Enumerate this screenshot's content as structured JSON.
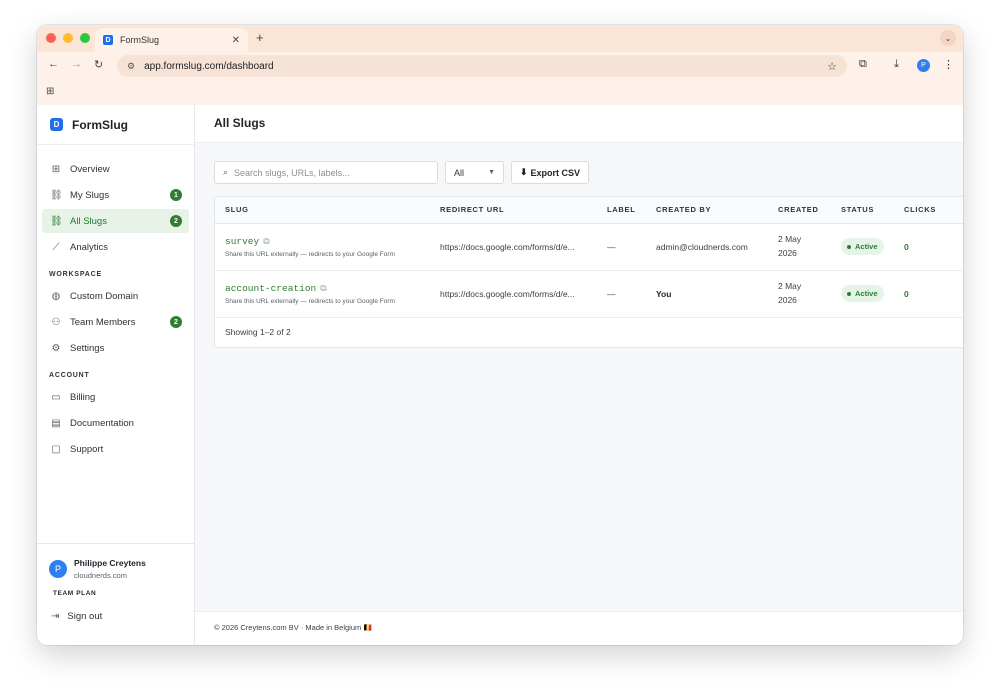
{
  "browser": {
    "tab_title": "FormSlug",
    "new_tab": "+",
    "url": "app.formslug.com/dashboard",
    "profile_initial": "P"
  },
  "brand": {
    "name": "FormSlug",
    "logo_letter": "D"
  },
  "sidebar": {
    "items": [
      {
        "label": "Overview",
        "icon": "grid-icon",
        "glyph": "⊞"
      },
      {
        "label": "My Slugs",
        "icon": "link-icon",
        "glyph": "🔗",
        "badge": "1"
      },
      {
        "label": "All Slugs",
        "icon": "link-icon",
        "glyph": "🔗",
        "badge": "2",
        "active": true
      },
      {
        "label": "Analytics",
        "icon": "chart-icon",
        "glyph": "📈"
      }
    ],
    "workspace_label": "WORKSPACE",
    "workspace_items": [
      {
        "label": "Custom Domain",
        "icon": "globe-icon",
        "glyph": "🌐"
      },
      {
        "label": "Team Members",
        "icon": "users-icon",
        "glyph": "👥",
        "badge": "2"
      },
      {
        "label": "Settings",
        "icon": "gear-icon",
        "glyph": "⚙"
      }
    ],
    "account_label": "ACCOUNT",
    "account_items": [
      {
        "label": "Billing",
        "icon": "credit-card-icon",
        "glyph": "▭"
      },
      {
        "label": "Documentation",
        "icon": "document-icon",
        "glyph": "📄"
      },
      {
        "label": "Support",
        "icon": "chat-icon",
        "glyph": "💬"
      }
    ],
    "user": {
      "initial": "P",
      "name": "Philippe Creytens",
      "domain": "cloudnerds.com",
      "plan": "TEAM PLAN"
    },
    "signout_label": "Sign out"
  },
  "main": {
    "title": "All Slugs",
    "search_placeholder": "Search slugs, URLs, labels...",
    "filter_value": "All",
    "export_label": "Export CSV",
    "columns": [
      "SLUG",
      "REDIRECT URL",
      "LABEL",
      "CREATED BY",
      "CREATED",
      "STATUS",
      "CLICKS"
    ],
    "rows": [
      {
        "slug": "survey",
        "help": "Share this URL externally — redirects to your Google Form",
        "redirect": "https://docs.google.com/forms/d/e...",
        "label": "—",
        "created_by": "admin@cloudnerds.com",
        "created_line1": "2 May",
        "created_line2": "2026",
        "status": "Active",
        "clicks": "0"
      },
      {
        "slug": "account-creation",
        "help": "Share this URL externally — redirects to your Google Form",
        "redirect": "https://docs.google.com/forms/d/e...",
        "label": "—",
        "created_by": "You",
        "created_line1": "2 May",
        "created_line2": "2026",
        "status": "Active",
        "clicks": "0"
      }
    ],
    "showing": "Showing 1–2 of 2"
  },
  "footer": {
    "text": "© 2026 Creytens.com BV · Made in Belgium 🇧🇪"
  },
  "colors": {
    "accent_green": "#2e7d32",
    "brand_blue": "#1f6feb",
    "chrome_peach": "#fbe5d6"
  }
}
